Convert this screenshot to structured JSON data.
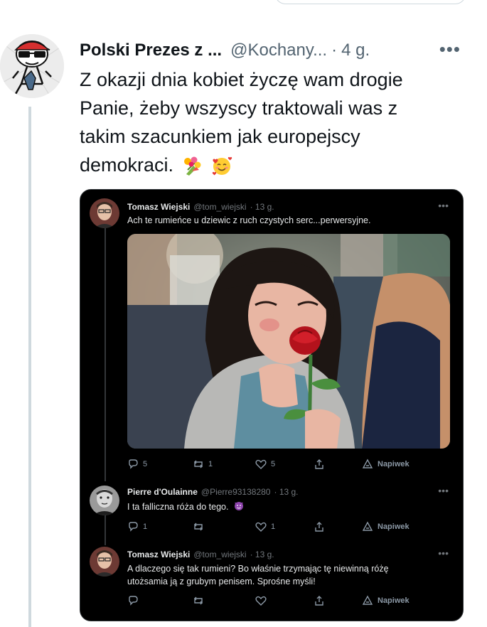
{
  "tweet": {
    "author_name": "Polski Prezes z ...",
    "author_handle": "@Kochany...",
    "separator": "·",
    "time": "4 g.",
    "more_label": "•••",
    "text": "Z okazji dnia kobiet życzę wam drogie Panie, żeby wszyscy traktowali was z takim szacunkiem jak europejscy demokraci.",
    "emojis": [
      "bouquet-icon",
      "smiling-face-with-hearts-icon"
    ]
  },
  "screenshot": {
    "posts": [
      {
        "name": "Tomasz Wiejski",
        "handle": "@tom_wiejski",
        "time": "· 13 g.",
        "text": "Ach te rumieńce u dziewic z ruch czystych serc...perwersyjne.",
        "actions": {
          "reply": "5",
          "retweet": "1",
          "like": "5",
          "tip": "Napiwek"
        }
      },
      {
        "name": "Pierre d'Oulainne",
        "handle": "@Pierre93138280",
        "time": "· 13 g.",
        "text": "I ta falliczna róża do tego.",
        "emoji": "smiling-devil-icon",
        "actions": {
          "reply": "1",
          "retweet": "",
          "like": "1",
          "tip": "Napiwek"
        }
      },
      {
        "name": "Tomasz Wiejski",
        "handle": "@tom_wiejski",
        "time": "· 13 g.",
        "text": "A dlaczego się tak rumieni? Bo właśnie trzymając tę niewinną różę utożsamia ją z grubym penisem. Sprośne myśli!",
        "actions": {
          "reply": "",
          "retweet": "",
          "like": "",
          "tip": "Napiwek"
        }
      }
    ],
    "more_label": "•••"
  }
}
